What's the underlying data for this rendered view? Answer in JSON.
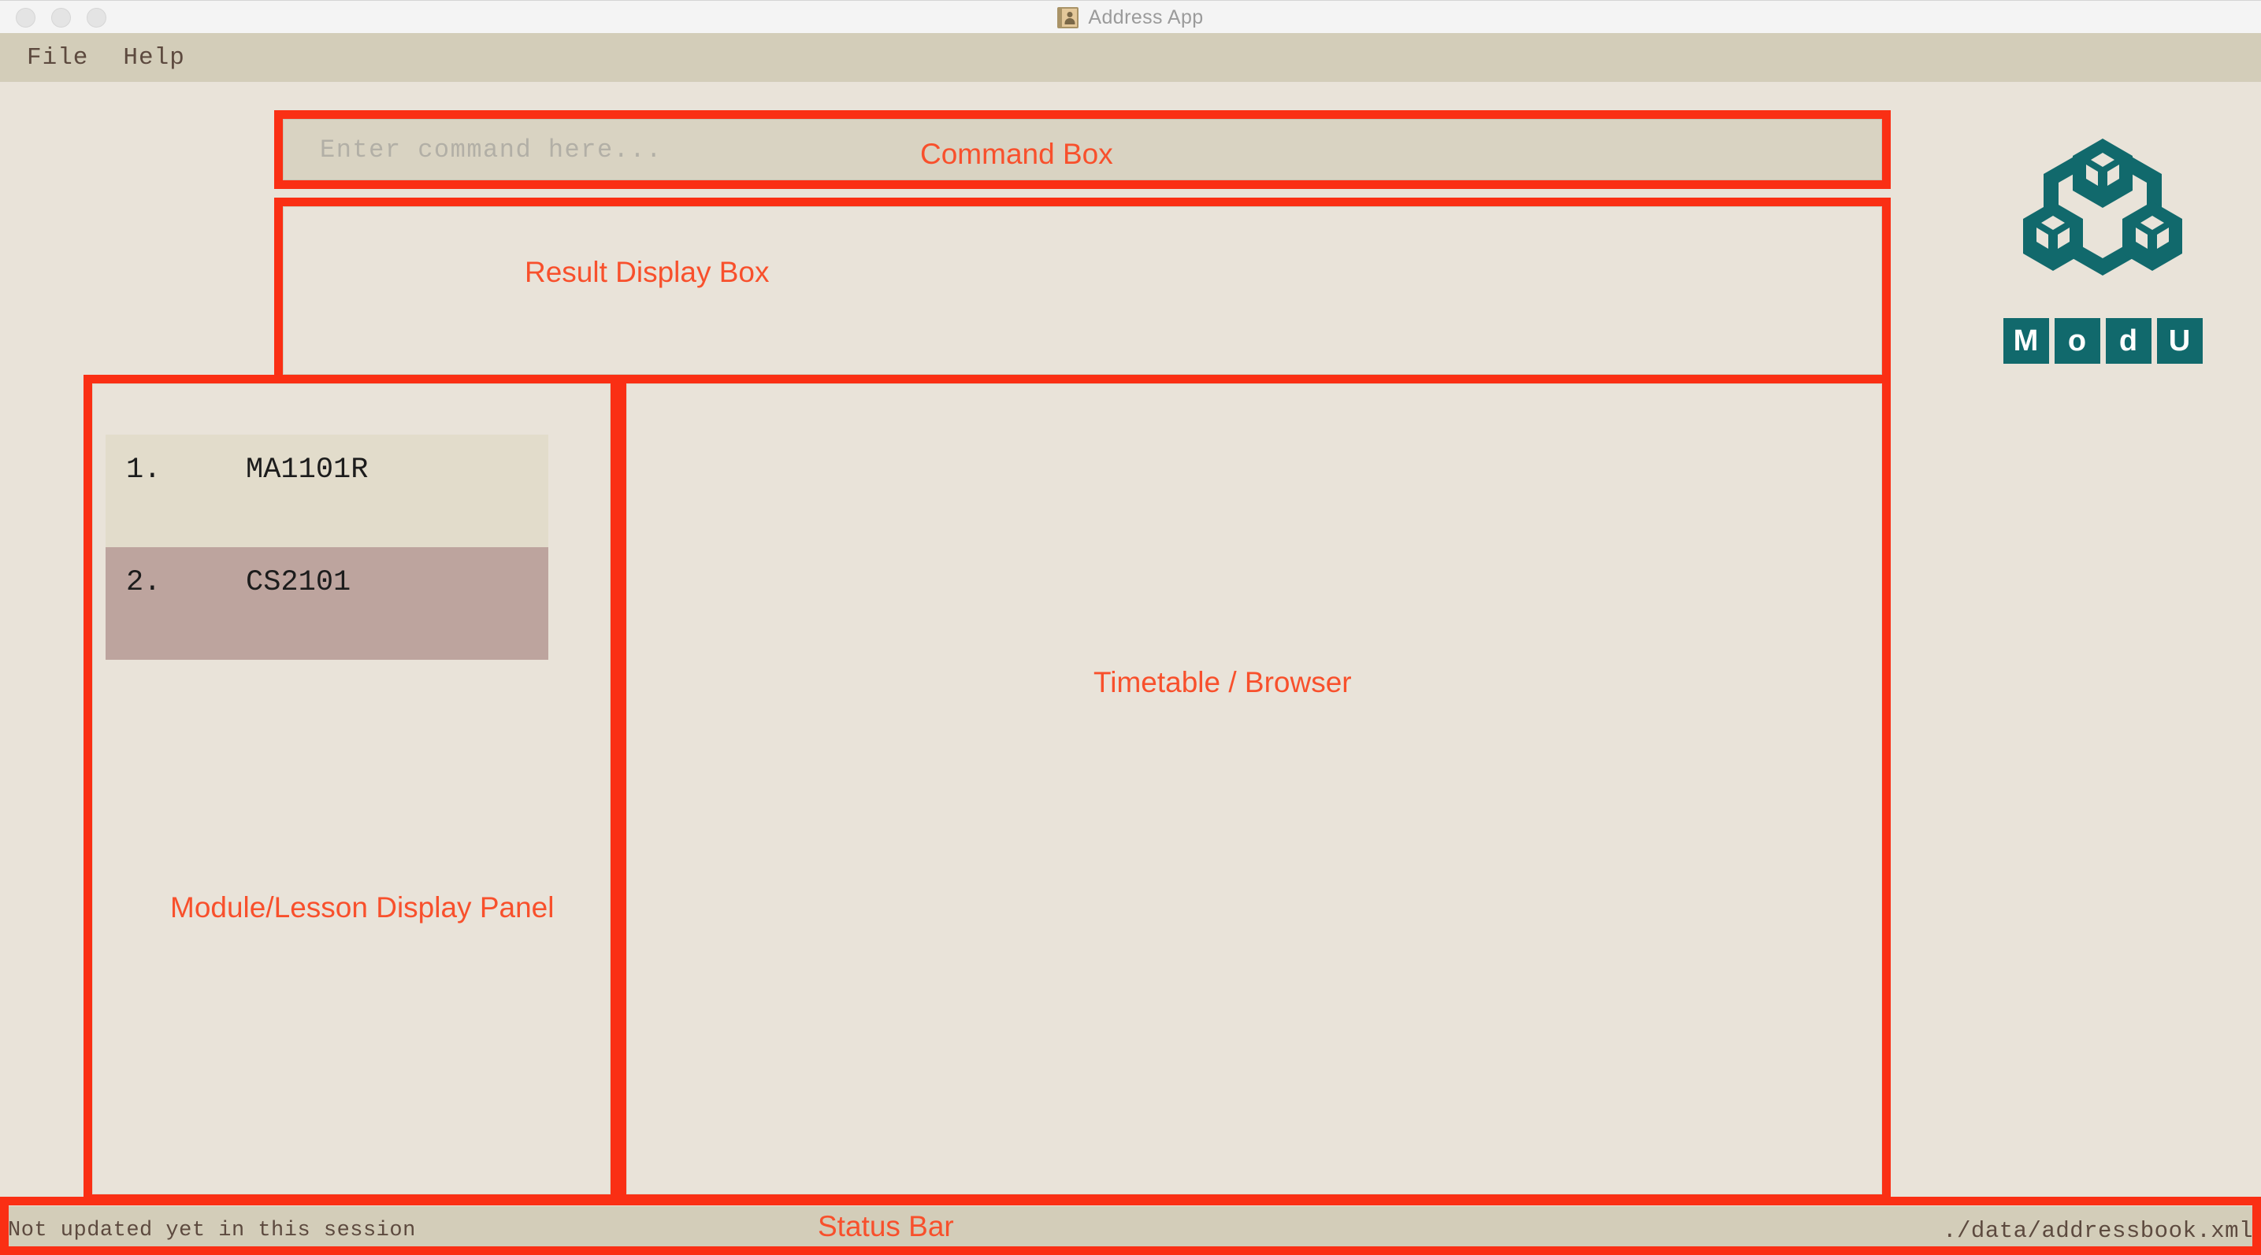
{
  "window": {
    "title": "Address App",
    "title_icon": "address-book-icon",
    "traffic_lights": [
      "close",
      "minimize",
      "maximize"
    ]
  },
  "menubar": {
    "items": [
      {
        "label": "File"
      },
      {
        "label": "Help"
      }
    ]
  },
  "command": {
    "placeholder": "Enter command here...",
    "value": ""
  },
  "result_display": {
    "text": ""
  },
  "module_panel": {
    "items": [
      {
        "index": "1.",
        "code": "MA1101R",
        "selected": false
      },
      {
        "index": "2.",
        "code": "CS2101",
        "selected": true
      }
    ]
  },
  "timetable": {
    "content": ""
  },
  "logo": {
    "letters": [
      "M",
      "o",
      "d",
      "U"
    ],
    "color": "#11696c"
  },
  "statusbar": {
    "sync_status": "Not updated yet in this session",
    "file_path": "./data/addressbook.xml"
  },
  "annotations": {
    "accent_color": "#fa2f14",
    "label_color": "#f8502c",
    "command_box": "Command Box",
    "result_display_box": "Result Display Box",
    "module_panel": "Module/Lesson Display Panel",
    "timetable": "Timetable / Browser",
    "status_bar": "Status Bar"
  },
  "colors": {
    "background": "#e9e3d9",
    "chrome": "#d3cdb9",
    "field": "#d9d3c2",
    "list_item": "#e2dccb",
    "list_item_selected": "#bda49e",
    "text": "#5d4a3f",
    "placeholder": "#b2afa6",
    "brand_teal": "#11696c",
    "annotation_red": "#fa2f14"
  }
}
